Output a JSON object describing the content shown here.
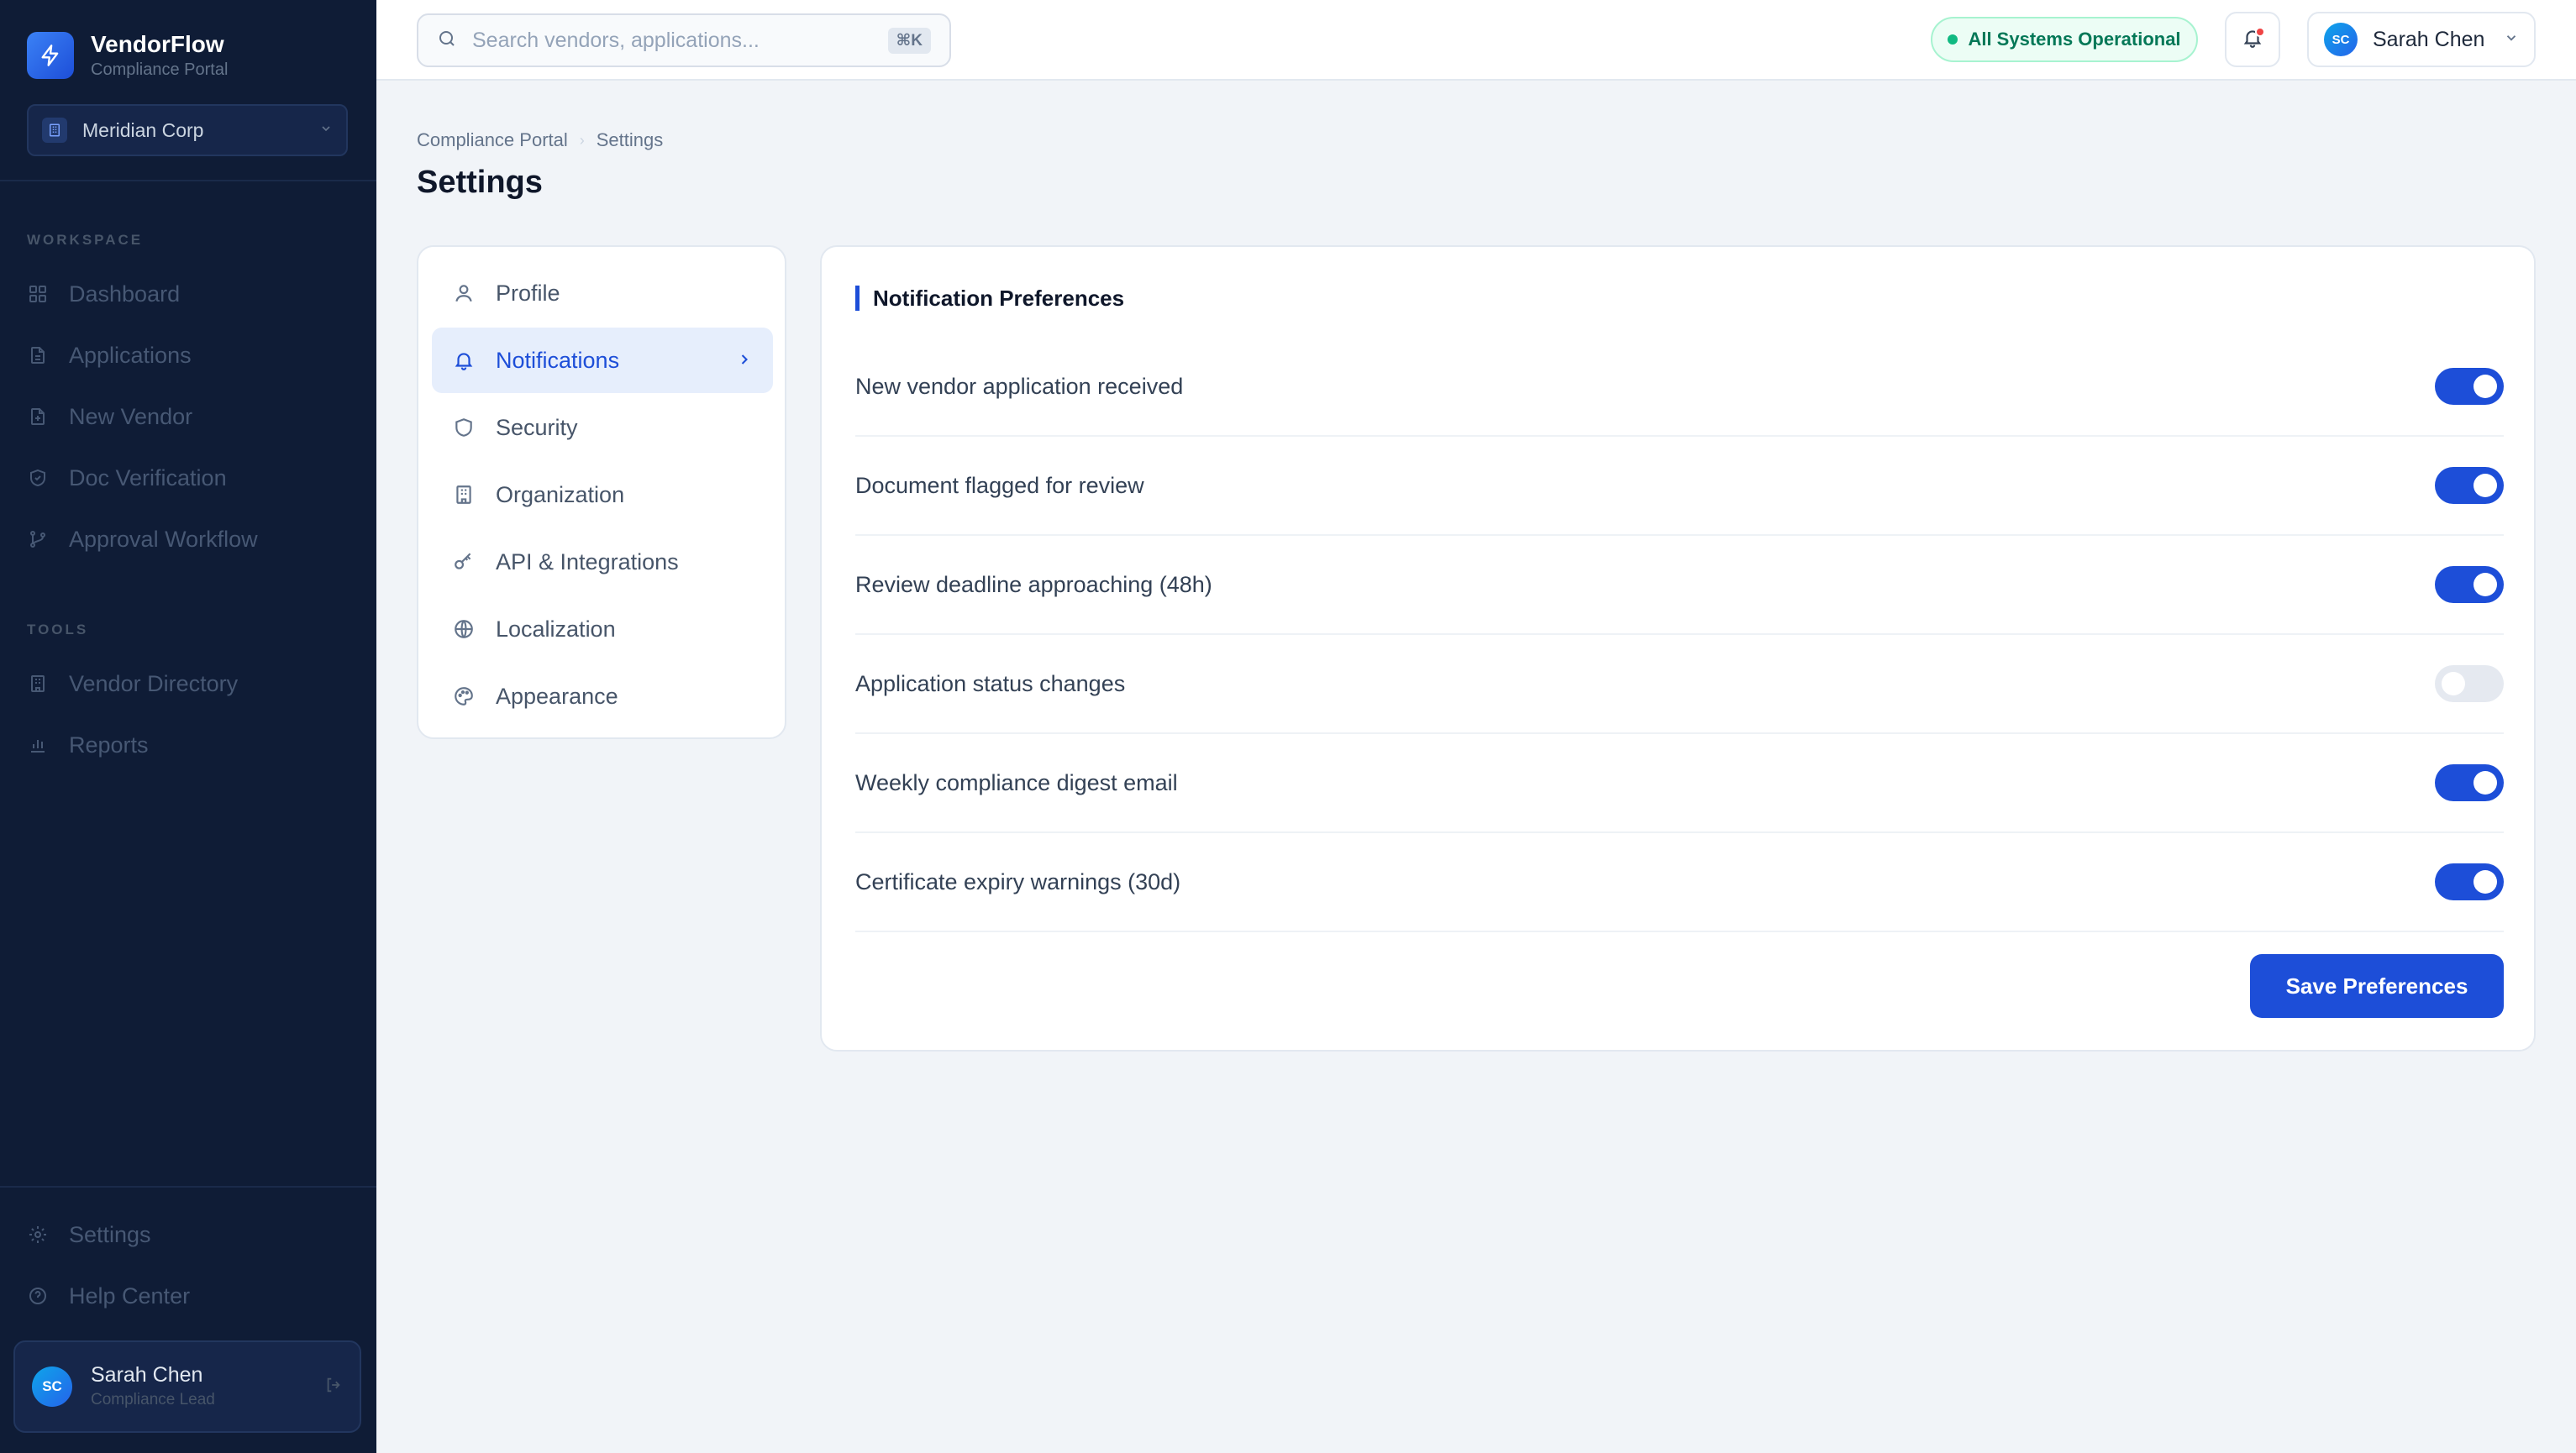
{
  "brand": {
    "name": "VendorFlow",
    "subtitle": "Compliance Portal"
  },
  "org": {
    "name": "Meridian Corp"
  },
  "sidebar": {
    "workspace_label": "WORKSPACE",
    "workspace_items": [
      {
        "label": "Dashboard",
        "icon": "grid-icon"
      },
      {
        "label": "Applications",
        "icon": "document-icon"
      },
      {
        "label": "New Vendor",
        "icon": "file-plus-icon"
      },
      {
        "label": "Doc Verification",
        "icon": "shield-check-icon"
      },
      {
        "label": "Approval Workflow",
        "icon": "git-branch-icon"
      }
    ],
    "tools_label": "TOOLS",
    "tools_items": [
      {
        "label": "Vendor Directory",
        "icon": "building-icon"
      },
      {
        "label": "Reports",
        "icon": "bar-chart-icon"
      }
    ],
    "bottom_items": [
      {
        "label": "Settings",
        "icon": "gear-icon"
      },
      {
        "label": "Help Center",
        "icon": "help-circle-icon"
      }
    ],
    "user": {
      "initials": "SC",
      "name": "Sarah Chen",
      "role": "Compliance Lead"
    }
  },
  "topbar": {
    "search_placeholder": "Search vendors, applications...",
    "shortcut": "⌘K",
    "status": "All Systems Operational",
    "user_initials": "SC",
    "user_name": "Sarah Chen"
  },
  "breadcrumb": [
    "Compliance Portal",
    "Settings"
  ],
  "page_title": "Settings",
  "settings_nav": [
    {
      "label": "Profile",
      "icon": "user-icon"
    },
    {
      "label": "Notifications",
      "icon": "bell-icon",
      "active": true
    },
    {
      "label": "Security",
      "icon": "shield-icon"
    },
    {
      "label": "Organization",
      "icon": "building-icon"
    },
    {
      "label": "API & Integrations",
      "icon": "key-icon"
    },
    {
      "label": "Localization",
      "icon": "globe-icon"
    },
    {
      "label": "Appearance",
      "icon": "palette-icon"
    }
  ],
  "panel": {
    "title": "Notification Preferences",
    "preferences": [
      {
        "label": "New vendor application received",
        "enabled": true
      },
      {
        "label": "Document flagged for review",
        "enabled": true
      },
      {
        "label": "Review deadline approaching (48h)",
        "enabled": true
      },
      {
        "label": "Application status changes",
        "enabled": false
      },
      {
        "label": "Weekly compliance digest email",
        "enabled": true
      },
      {
        "label": "Certificate expiry warnings (30d)",
        "enabled": true
      }
    ],
    "save_label": "Save Preferences"
  },
  "colors": {
    "accent": "#1d4ed8",
    "sidebar_bg": "#0f1c36",
    "status_green": "#10b981",
    "page_bg": "#f1f4f8"
  }
}
